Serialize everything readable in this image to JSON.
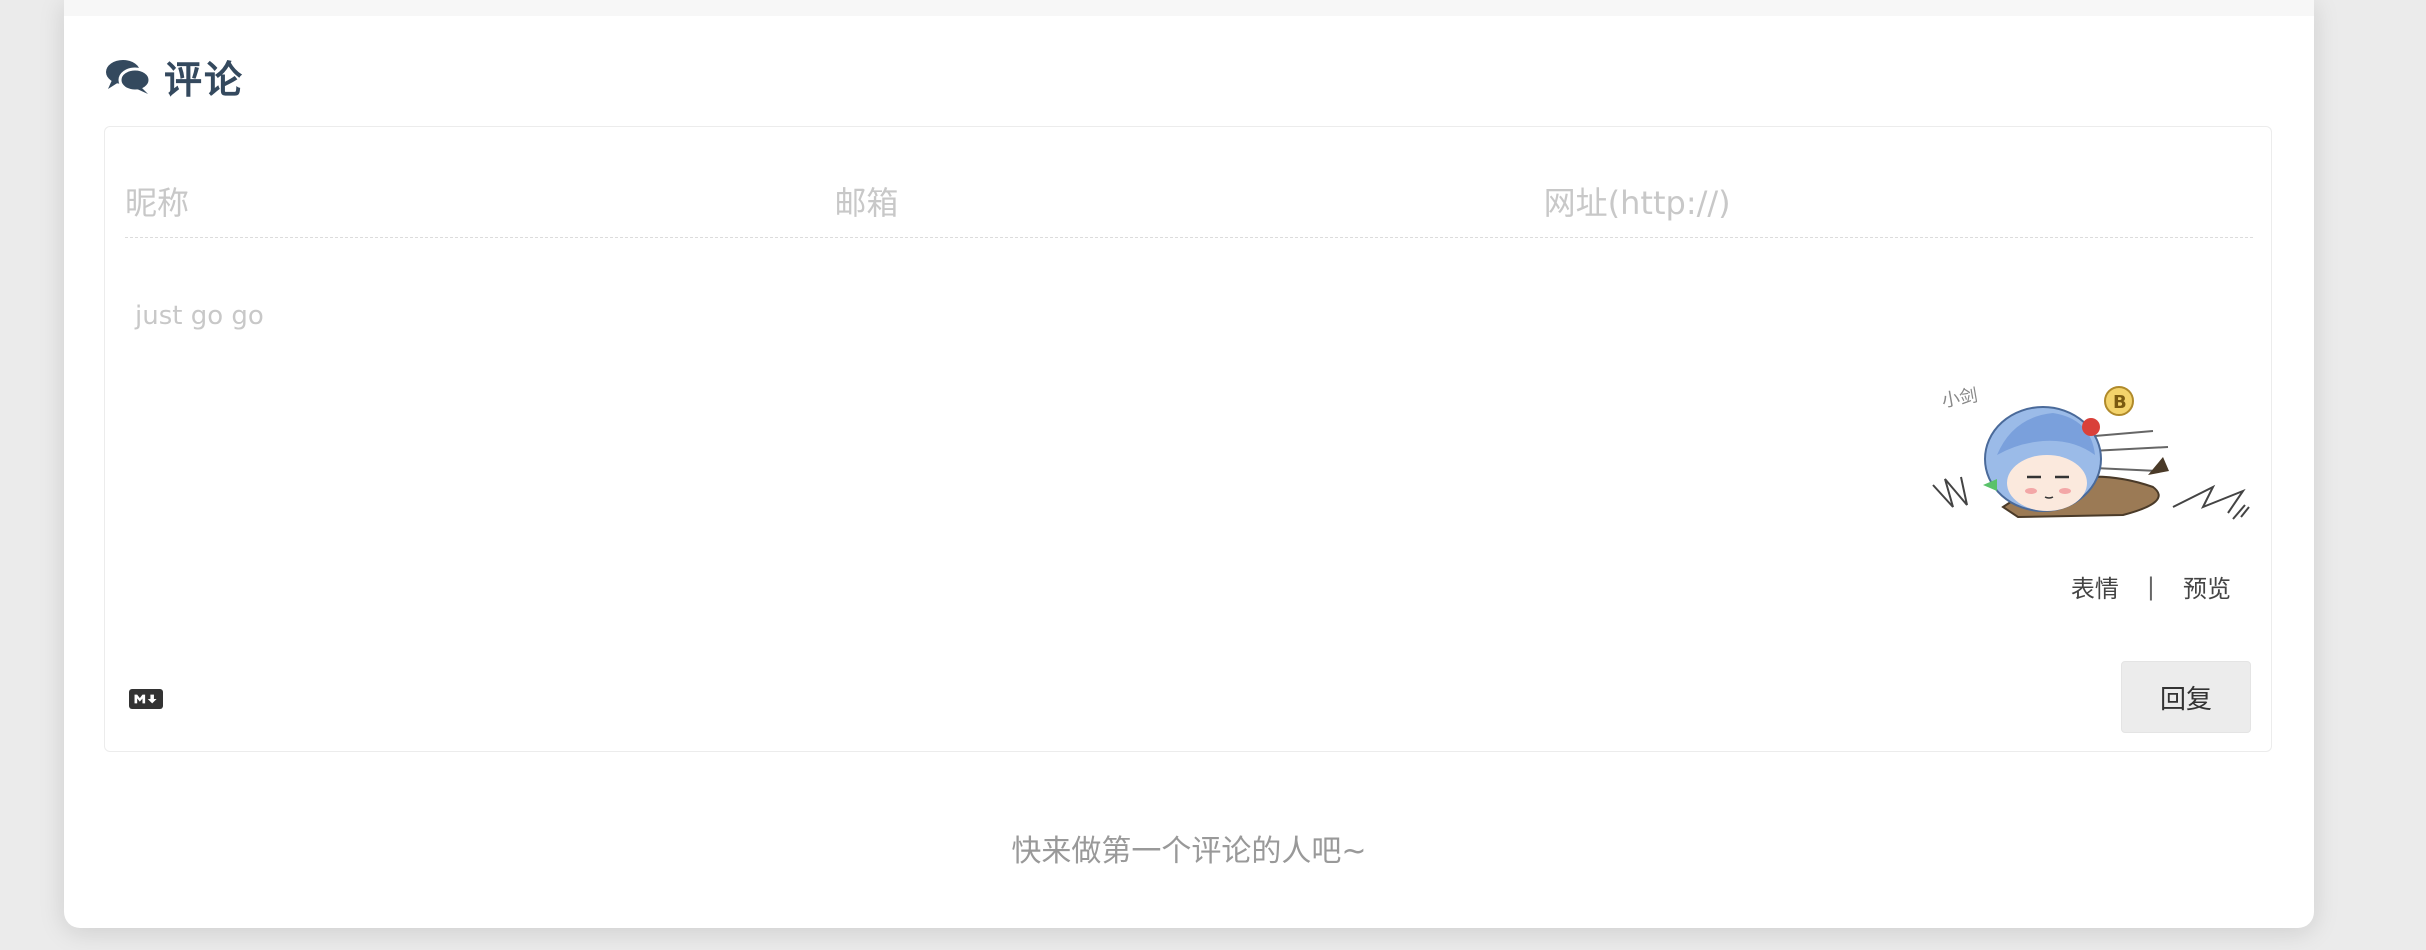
{
  "comments": {
    "title": "评论",
    "nick_placeholder": "昵称",
    "mail_placeholder": "邮箱",
    "link_placeholder": "网址(http://)",
    "editor_placeholder": "just go go",
    "tools": {
      "emoji_label": "表情",
      "separator": "|",
      "preview_label": "预览"
    },
    "reply_label": "回复",
    "empty_message": "快来做第一个评论的人吧~",
    "mascot_doodle_text": "小剑",
    "mascot_badge_text": "B"
  }
}
